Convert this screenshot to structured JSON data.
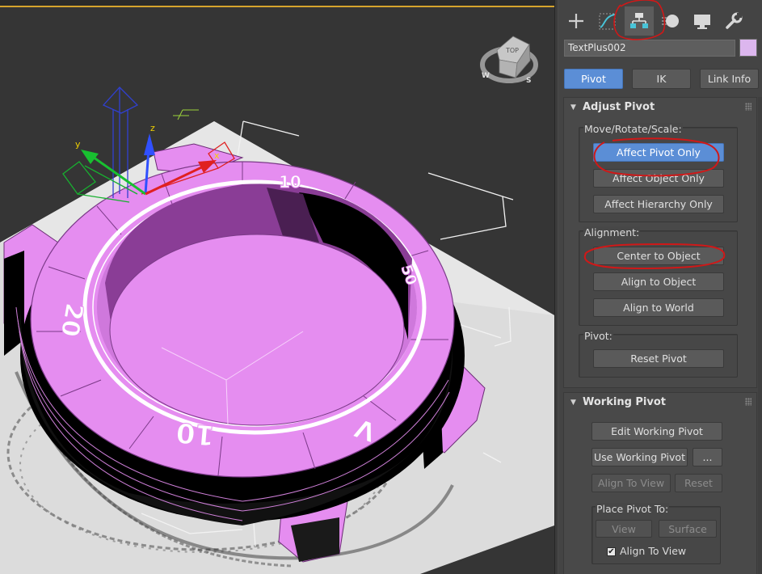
{
  "viewport": {
    "navcube": {
      "face_label": "TOP",
      "compass": [
        "W",
        "S"
      ]
    },
    "gizmo_axes": [
      "x",
      "y",
      "z"
    ],
    "watch_text": [
      "10",
      "20",
      "10",
      "50",
      "V",
      "01"
    ],
    "colors": {
      "mesh": "#e58df0",
      "mesh_dark": "#8a3d96",
      "background": "#353535"
    }
  },
  "command_panel": {
    "tabs": [
      {
        "name": "create",
        "icon": "plus-icon"
      },
      {
        "name": "modify",
        "icon": "modify-curve-icon"
      },
      {
        "name": "hierarchy",
        "icon": "hierarchy-icon",
        "active": true
      },
      {
        "name": "motion",
        "icon": "motion-icon"
      },
      {
        "name": "display",
        "icon": "display-monitor-icon"
      },
      {
        "name": "utilities",
        "icon": "wrench-icon"
      }
    ],
    "object_name": "TextPlus002",
    "object_color": "#dcb6ee",
    "mode_buttons": {
      "pivot": "Pivot",
      "ik": "IK",
      "link_info": "Link Info"
    },
    "adjust_pivot": {
      "title": "Adjust Pivot",
      "move_rotate_scale_label": "Move/Rotate/Scale:",
      "affect_pivot_only": "Affect Pivot Only",
      "affect_object_only": "Affect Object Only",
      "affect_hierarchy_only": "Affect Hierarchy Only",
      "alignment_label": "Alignment:",
      "center_to_object": "Center to Object",
      "align_to_object": "Align to Object",
      "align_to_world": "Align to World",
      "pivot_label": "Pivot:",
      "reset_pivot": "Reset Pivot"
    },
    "working_pivot": {
      "title": "Working Pivot",
      "edit_working_pivot": "Edit Working Pivot",
      "use_working_pivot": "Use Working Pivot",
      "more": "...",
      "align_to_view": "Align To View",
      "reset": "Reset",
      "place_pivot_to_label": "Place Pivot To:",
      "view": "View",
      "surface": "Surface",
      "align_to_view_check": "Align To View",
      "align_to_view_checked": true
    }
  },
  "annotations": {
    "color": "#d01818"
  }
}
